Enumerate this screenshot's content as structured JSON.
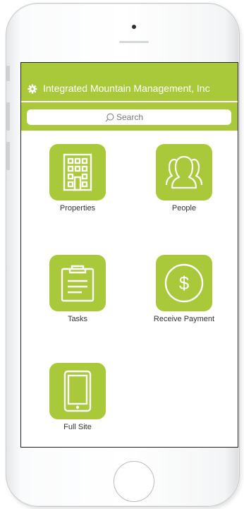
{
  "header": {
    "title": "Integrated Mountain Management, Inc",
    "icon": "gear-icon"
  },
  "search": {
    "placeholder": "Search",
    "icon": "search-icon"
  },
  "tiles": [
    {
      "label": "Properties",
      "icon": "building-icon"
    },
    {
      "label": "People",
      "icon": "people-icon"
    },
    {
      "label": "Tasks",
      "icon": "clipboard-icon"
    },
    {
      "label": "Receive Payment",
      "icon": "dollar-icon",
      "symbol": "$"
    },
    {
      "label": "Full Site",
      "icon": "tablet-icon"
    }
  ],
  "colors": {
    "accent": "#a9c93b",
    "text": "#333333",
    "header_text": "#ffffff"
  }
}
